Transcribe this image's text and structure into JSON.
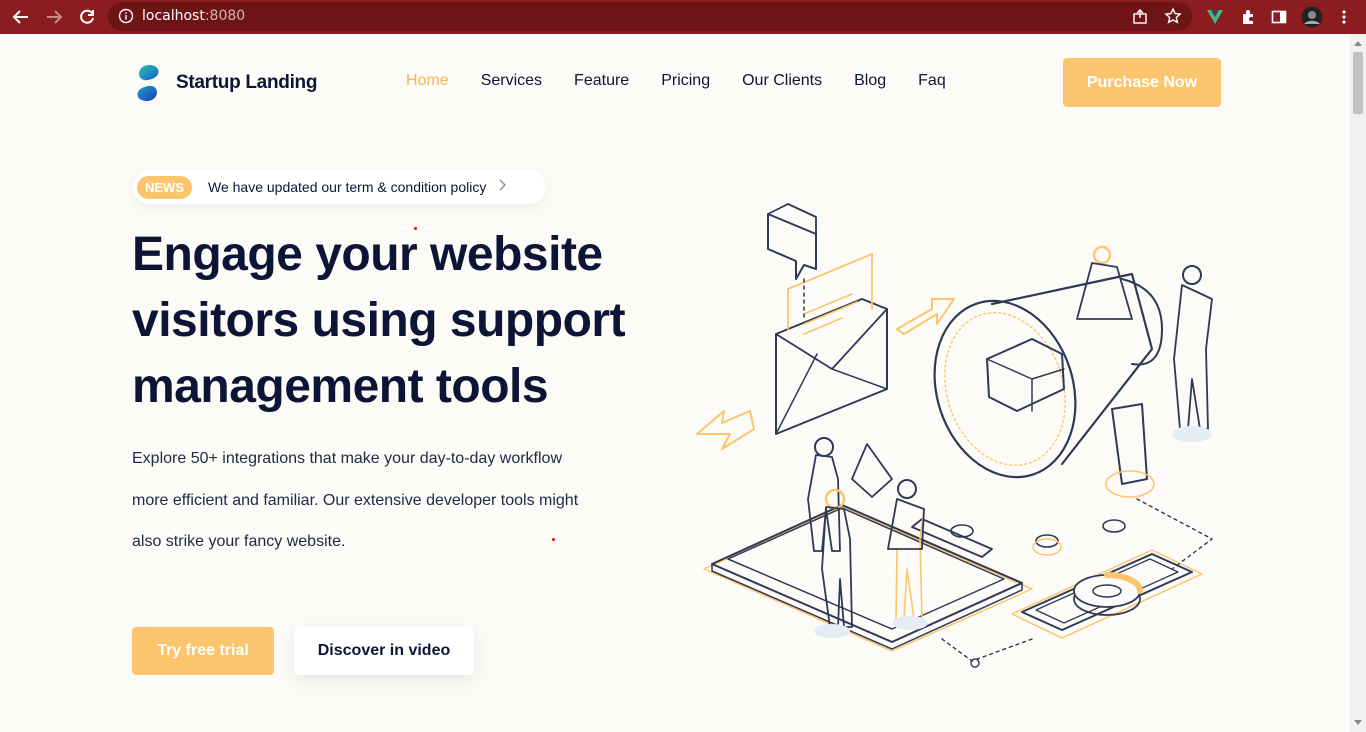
{
  "browser": {
    "url_host": "localhost",
    "url_port": ":8080"
  },
  "header": {
    "brand": "Startup Landing",
    "menu": [
      {
        "label": "Home",
        "active": true
      },
      {
        "label": "Services",
        "active": false
      },
      {
        "label": "Feature",
        "active": false
      },
      {
        "label": "Pricing",
        "active": false
      },
      {
        "label": "Our Clients",
        "active": false
      },
      {
        "label": "Blog",
        "active": false
      },
      {
        "label": "Faq",
        "active": false
      }
    ],
    "purchase_label": "Purchase Now"
  },
  "hero": {
    "news_badge": "NEWS",
    "news_text": "We have updated our term & condition policy",
    "headline_line1": "Engage your website",
    "headline_line2": "visitors using support",
    "headline_line3": "management tools",
    "desc_line1": "Explore 50+ integrations that make your day-to-day workflow",
    "desc_line2": "more efficient and familiar. Our extensive developer tools might",
    "desc_line3": "also strike your fancy website.",
    "primary_cta": "Try free trial",
    "secondary_cta": "Discover in video"
  },
  "colors": {
    "accent": "#fbc56d",
    "navy": "#0c1536",
    "chrome_bar": "#8b1c1f"
  }
}
